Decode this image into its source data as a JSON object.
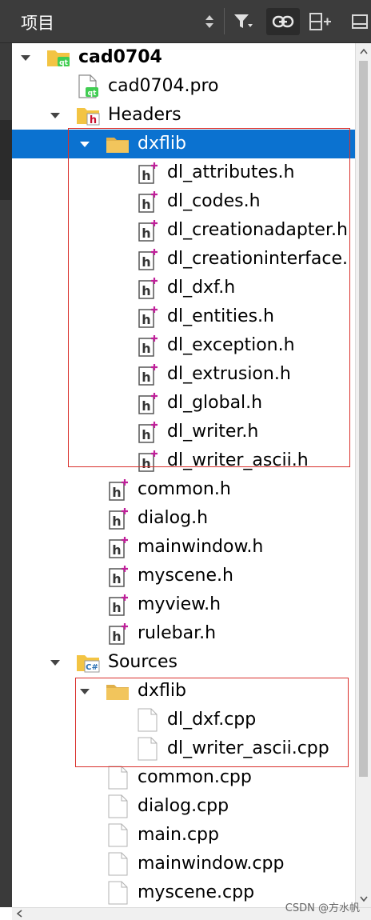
{
  "toolbar": {
    "title": "项目"
  },
  "tree": {
    "rows": [
      {
        "label": "cad0704",
        "bold": true,
        "indent": 0,
        "expanded": true,
        "icon": "qt-project-folder-icon"
      },
      {
        "label": "cad0704.pro",
        "indent": 1,
        "icon": "qt-pro-file-icon"
      },
      {
        "label": "Headers",
        "indent": 1,
        "expanded": true,
        "icon": "headers-folder-icon"
      },
      {
        "label": "dxflib",
        "indent": 2,
        "expanded": true,
        "selected": true,
        "icon": "folder-icon"
      },
      {
        "label": "dl_attributes.h",
        "indent": 3,
        "icon": "header-file-icon"
      },
      {
        "label": "dl_codes.h",
        "indent": 3,
        "icon": "header-file-icon"
      },
      {
        "label": "dl_creationadapter.h",
        "indent": 3,
        "icon": "header-file-icon"
      },
      {
        "label": "dl_creationinterface.",
        "indent": 3,
        "icon": "header-file-icon"
      },
      {
        "label": "dl_dxf.h",
        "indent": 3,
        "icon": "header-file-icon"
      },
      {
        "label": "dl_entities.h",
        "indent": 3,
        "icon": "header-file-icon"
      },
      {
        "label": "dl_exception.h",
        "indent": 3,
        "icon": "header-file-icon"
      },
      {
        "label": "dl_extrusion.h",
        "indent": 3,
        "icon": "header-file-icon"
      },
      {
        "label": "dl_global.h",
        "indent": 3,
        "icon": "header-file-icon"
      },
      {
        "label": "dl_writer.h",
        "indent": 3,
        "icon": "header-file-icon"
      },
      {
        "label": "dl_writer_ascii.h",
        "indent": 3,
        "icon": "header-file-icon"
      },
      {
        "label": "common.h",
        "indent": 2,
        "icon": "header-file-icon"
      },
      {
        "label": "dialog.h",
        "indent": 2,
        "icon": "header-file-icon"
      },
      {
        "label": "mainwindow.h",
        "indent": 2,
        "icon": "header-file-icon"
      },
      {
        "label": "myscene.h",
        "indent": 2,
        "icon": "header-file-icon"
      },
      {
        "label": "myview.h",
        "indent": 2,
        "icon": "header-file-icon"
      },
      {
        "label": "rulebar.h",
        "indent": 2,
        "icon": "header-file-icon"
      },
      {
        "label": "Sources",
        "indent": 1,
        "expanded": true,
        "icon": "sources-folder-icon"
      },
      {
        "label": "dxflib",
        "indent": 2,
        "expanded": true,
        "icon": "folder-icon"
      },
      {
        "label": "dl_dxf.cpp",
        "indent": 3,
        "icon": "source-file-icon"
      },
      {
        "label": "dl_writer_ascii.cpp",
        "indent": 3,
        "icon": "source-file-icon"
      },
      {
        "label": "common.cpp",
        "indent": 2,
        "icon": "source-file-icon"
      },
      {
        "label": "dialog.cpp",
        "indent": 2,
        "icon": "source-file-icon"
      },
      {
        "label": "main.cpp",
        "indent": 2,
        "icon": "source-file-icon"
      },
      {
        "label": "mainwindow.cpp",
        "indent": 2,
        "icon": "source-file-icon"
      },
      {
        "label": "myscene.cpp",
        "indent": 2,
        "icon": "source-file-icon"
      }
    ]
  },
  "watermark": "CSDN @方水帆",
  "colors": {
    "toolbar_bg": "#3c3c3c",
    "selection": "#0b72d0",
    "annotation_red": "#d9302b",
    "folder_yellow": "#f3c443",
    "header_mark": "#c0209a"
  }
}
